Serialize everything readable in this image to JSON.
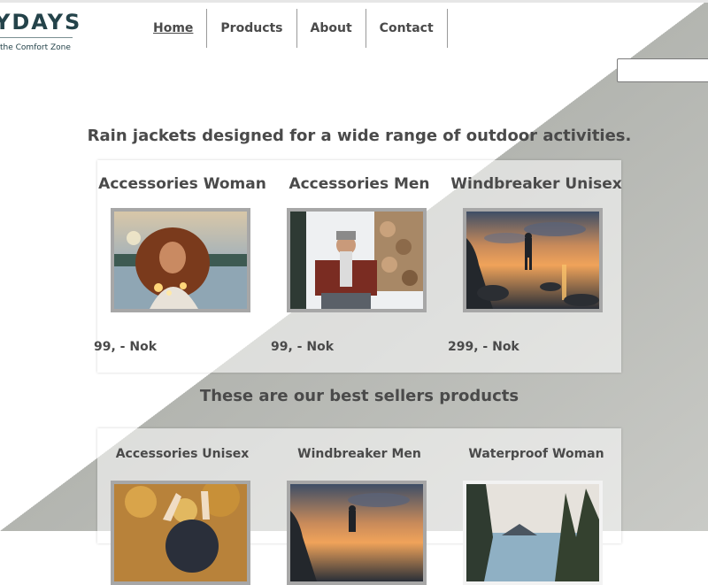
{
  "brand": {
    "name": "YDAYS",
    "tagline": "the Comfort Zone"
  },
  "nav": [
    {
      "label": "Home",
      "active": true
    },
    {
      "label": "Products",
      "active": false
    },
    {
      "label": "About",
      "active": false
    },
    {
      "label": "Contact",
      "active": false
    }
  ],
  "search": {
    "value": "",
    "placeholder": ""
  },
  "section1": {
    "heading": "Rain jackets designed for a wide range of outdoor activities.",
    "products": [
      {
        "title": "Accessories Woman",
        "price": "99, - Nok",
        "image": "woman-with-lights-photo"
      },
      {
        "title": "Accessories Men",
        "price": "99, - Nok",
        "image": "man-in-snow-photo"
      },
      {
        "title": "Windbreaker Unisex",
        "price": "299, - Nok",
        "image": "sunset-coast-photo"
      }
    ]
  },
  "section2": {
    "heading": "These are our best sellers products",
    "products": [
      {
        "title": "Accessories Unisex",
        "image": "autumn-forest-photo"
      },
      {
        "title": "Windbreaker Men",
        "image": "sunset-hiker-photo"
      },
      {
        "title": "Waterproof Woman",
        "image": "forest-lake-photo"
      }
    ]
  },
  "colors": {
    "brand": "#24434a",
    "text": "#4a4a4a",
    "diagonal": "#b3b5b0"
  }
}
